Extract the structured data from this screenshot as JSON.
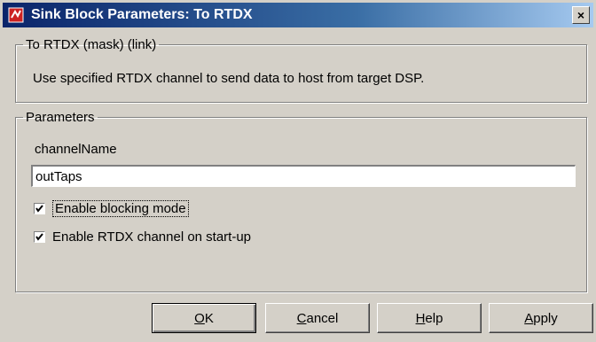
{
  "window": {
    "title": "Sink Block Parameters: To RTDX",
    "close_label": "×"
  },
  "mask_group": {
    "legend": "To RTDX (mask) (link)",
    "description": "Use specified RTDX channel to send data to host from target DSP."
  },
  "parameters": {
    "legend": "Parameters",
    "channel_label": "channelName",
    "channel_value": "outTaps",
    "blocking_label": "Enable blocking mode",
    "blocking_checked": true,
    "startup_label": "Enable RTDX channel on start-up",
    "startup_checked": true
  },
  "buttons": {
    "ok": {
      "accel": "O",
      "rest": "K"
    },
    "cancel": {
      "accel": "C",
      "rest": "ancel"
    },
    "help": {
      "accel": "H",
      "rest": "elp"
    },
    "apply": {
      "accel": "A",
      "rest": "pply"
    }
  },
  "icons": {
    "title": "simulink-block-icon",
    "close": "close-icon",
    "check": "check-icon"
  }
}
